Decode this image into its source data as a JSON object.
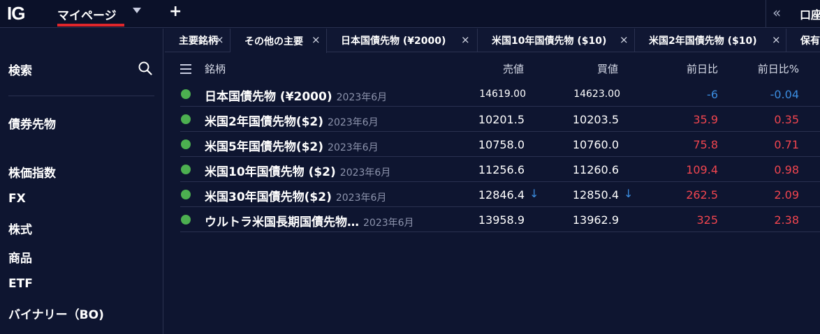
{
  "app": {
    "logo": "IG",
    "main_tab": "マイページ",
    "add_tab": "+",
    "collapse": "«",
    "account": "口座"
  },
  "sidebar": {
    "search_label": "検索",
    "items": [
      "債券先物",
      "株価指数",
      "FX",
      "株式",
      "商品",
      "ETF",
      "バイナリー（BO)"
    ]
  },
  "watchlist_tabs": [
    {
      "label": "主要銘柄",
      "close": "×"
    },
    {
      "label": "その他の主要",
      "close": "×"
    },
    {
      "label": "日本国債先物 (¥2000)",
      "close": "×"
    },
    {
      "label": "米国10年国債先物 ($10)",
      "close": "×"
    },
    {
      "label": "米国2年国債先物 ($10)",
      "close": "×"
    },
    {
      "label": "保有",
      "close": ""
    }
  ],
  "table": {
    "headers": {
      "name": "銘柄",
      "sell": "売値",
      "buy": "買値",
      "change": "前日比",
      "change_pct": "前日比%"
    },
    "rows": [
      {
        "name": "日本国債先物 (¥2000)",
        "expiry": "2023年6月",
        "sell": "14619.00",
        "buy": "14623.00",
        "change": "-6",
        "change_pct": "-0.04",
        "sell_arrow": "",
        "buy_arrow": ""
      },
      {
        "name": "米国2年国債先物($2)",
        "expiry": "2023年6月",
        "sell": "10201.5",
        "buy": "10203.5",
        "change": "35.9",
        "change_pct": "0.35",
        "sell_arrow": "",
        "buy_arrow": ""
      },
      {
        "name": "米国5年国債先物($2)",
        "expiry": "2023年6月",
        "sell": "10758.0",
        "buy": "10760.0",
        "change": "75.8",
        "change_pct": "0.71",
        "sell_arrow": "",
        "buy_arrow": ""
      },
      {
        "name": "米国10年国債先物 ($2)",
        "expiry": "2023年6月",
        "sell": "11256.6",
        "buy": "11260.6",
        "change": "109.4",
        "change_pct": "0.98",
        "sell_arrow": "",
        "buy_arrow": ""
      },
      {
        "name": "米国30年国債先物($2)",
        "expiry": "2023年6月",
        "sell": "12846.4",
        "buy": "12850.4",
        "change": "262.5",
        "change_pct": "2.09",
        "sell_arrow": "↓",
        "buy_arrow": "↓"
      },
      {
        "name": "ウルトラ米国長期国債先物…",
        "expiry": "2023年6月",
        "sell": "13958.9",
        "buy": "13962.9",
        "change": "325",
        "change_pct": "2.38",
        "sell_arrow": "",
        "buy_arrow": ""
      }
    ]
  },
  "colors": {
    "background": "#0e1530",
    "accent_red": "#e0262b",
    "up": "#f0454f",
    "down": "#3b8de0",
    "status_green": "#4caf50"
  }
}
